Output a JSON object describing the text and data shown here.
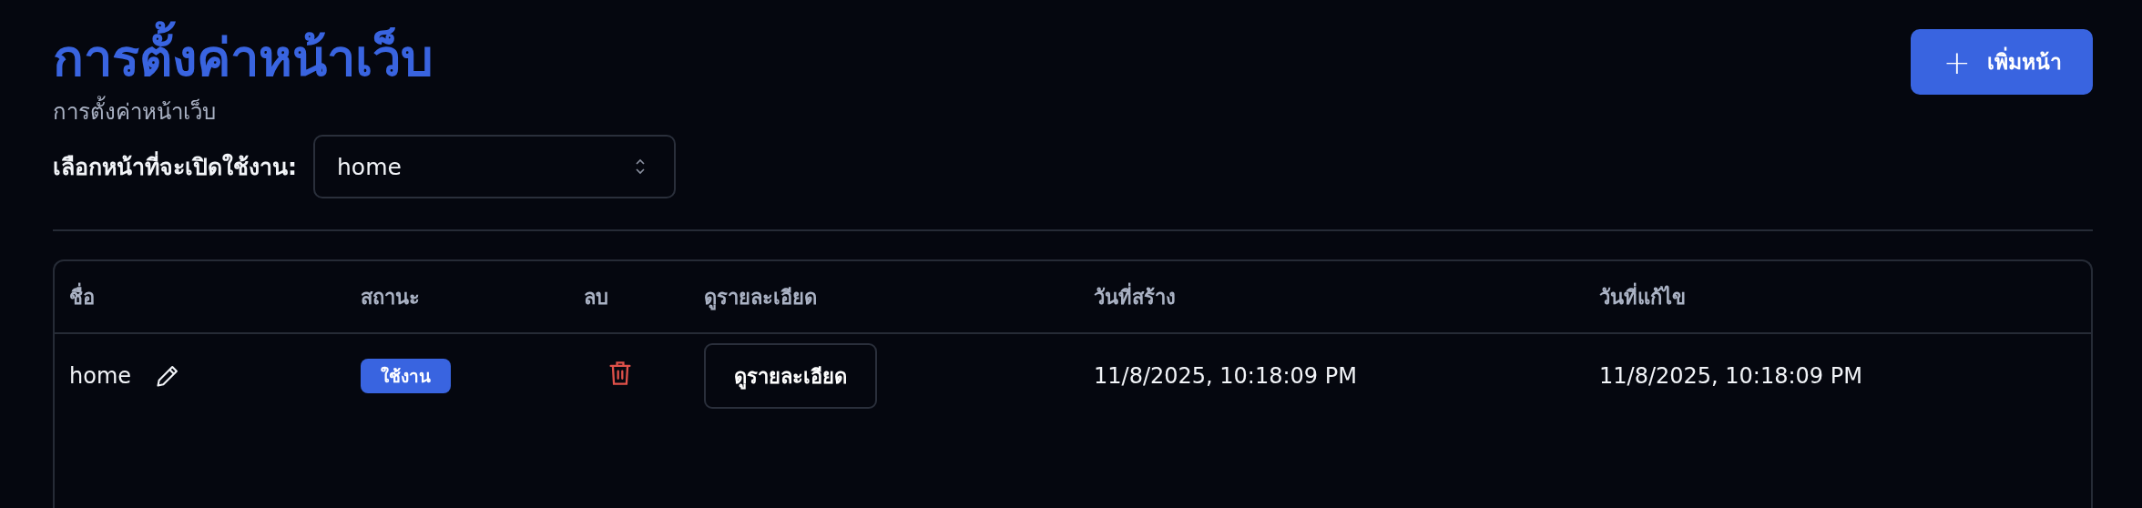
{
  "header": {
    "title": "การตั้งค่าหน้าเว็บ",
    "subtitle": "การตั้งค่าหน้าเว็บ",
    "add_button": {
      "icon": "+",
      "label": "เพิ่มหน้า"
    }
  },
  "page_select": {
    "label": "เลือกหน้าที่จะเปิดใช้งาน:",
    "value": "home"
  },
  "table": {
    "columns": [
      "ชื่อ",
      "สถานะ",
      "ลบ",
      "ดูรายละเอียด",
      "วันที่สร้าง",
      "วันที่แก้ไข"
    ],
    "rows": [
      {
        "name": "home",
        "status": "ใช้งาน",
        "active": true,
        "details_button": "ดูรายละเอียด",
        "created": "11/8/2025, 10:18:09 PM",
        "modified": "11/8/2025, 10:18:09 PM"
      }
    ]
  }
}
